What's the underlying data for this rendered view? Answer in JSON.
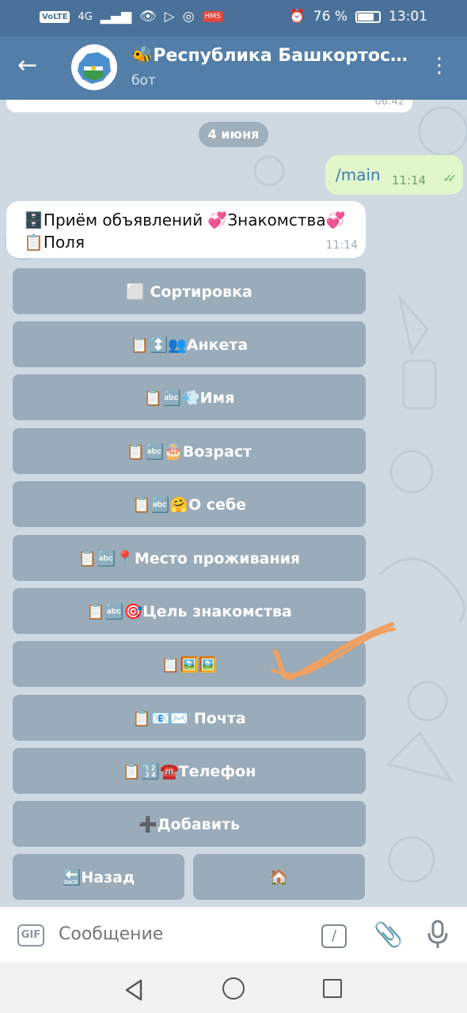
{
  "status": {
    "volte": "VoLTE",
    "network": "4G",
    "red_badge": "HMS",
    "battery": "76 %",
    "battery_level": 0.76,
    "time": "13:01"
  },
  "header": {
    "title": "🐝Республика Башкортоста…",
    "subtitle": "бот"
  },
  "chat": {
    "prev_time": "06:42",
    "date": "4 июня",
    "outgoing": {
      "text": "/main",
      "time": "11:14",
      "checks": "✓✓"
    },
    "incoming": {
      "line1": "🗄️Приём объявлений 💞Знакомства💞",
      "line2": "📋Поля",
      "time": "11:14"
    }
  },
  "keyboard": {
    "buttons": [
      "⬜ Сортировка",
      "📋↕️👥Анкета",
      "📋🔤💨Имя",
      "📋🔤🎂Возраст",
      "📋🔤🤗О себе",
      "📋🔤📍Место проживания",
      "📋🔤🎯Цель знакомства",
      "📋🖼️🖼️",
      "📋📧✉️ Почта",
      "📋🔢☎️Телефон",
      "➕Добавить"
    ],
    "back_label": "🔙Назад",
    "home_label": "🏠"
  },
  "input": {
    "gif": "GIF",
    "placeholder": "Сообщение",
    "slash": "/"
  },
  "colors": {
    "header": "#527ea7",
    "status_bar": "#4a7199",
    "keyboard_button": "#9aabb9",
    "outgoing_bubble": "#e1f6cb",
    "scribble": "#f0a060"
  }
}
